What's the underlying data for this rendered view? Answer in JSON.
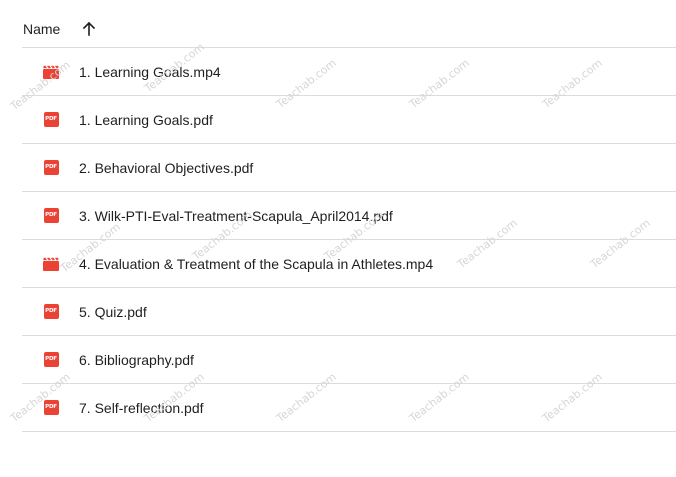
{
  "header": {
    "name_label": "Name",
    "sort_icon": "arrow-up-icon"
  },
  "files": [
    {
      "name": "1. Learning Goals.mp4",
      "type": "video",
      "icon": "video-file-icon"
    },
    {
      "name": "1. Learning Goals.pdf",
      "type": "pdf",
      "icon": "pdf-file-icon"
    },
    {
      "name": "2. Behavioral Objectives.pdf",
      "type": "pdf",
      "icon": "pdf-file-icon"
    },
    {
      "name": "3. Wilk-PTI-Eval-Treatment-Scapula_April2014.pdf",
      "type": "pdf",
      "icon": "pdf-file-icon"
    },
    {
      "name": "4. Evaluation & Treatment of the Scapula in Athletes.mp4",
      "type": "video",
      "icon": "video-file-icon"
    },
    {
      "name": "5. Quiz.pdf",
      "type": "pdf",
      "icon": "pdf-file-icon"
    },
    {
      "name": "6. Bibliography.pdf",
      "type": "pdf",
      "icon": "pdf-file-icon"
    },
    {
      "name": "7. Self-reflection.pdf",
      "type": "pdf",
      "icon": "pdf-file-icon"
    }
  ],
  "pdf_badge_text": "PDF",
  "watermark_text": "Teachab.com",
  "colors": {
    "file_icon_red": "#ea4335",
    "divider": "#dadce0",
    "text": "#1f1f1f"
  }
}
